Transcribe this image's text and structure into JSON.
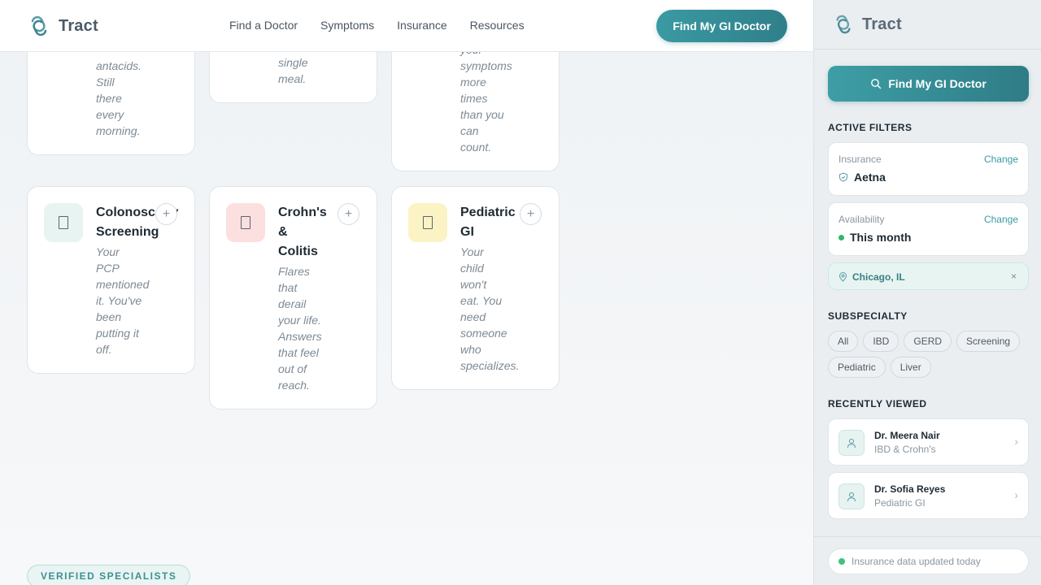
{
  "header": {
    "brand": "Tract",
    "nav": [
      "Find a Doctor",
      "Symptoms",
      "Insurance",
      "Resources"
    ],
    "cta": "Find My GI Doctor"
  },
  "partial_cards": [
    {
      "lines": [
        "antacids.",
        "Still",
        "there",
        "every",
        "morning."
      ]
    },
    {
      "lines": [
        "single",
        "meal."
      ]
    },
    {
      "lines": [
        "your",
        "symptoms",
        "more",
        "times",
        "than you",
        "can",
        "count."
      ]
    }
  ],
  "cards": [
    {
      "title_lines": [
        "Colonoscopy",
        "Screening"
      ],
      "desc_lines": [
        "Your",
        "PCP",
        "mentioned",
        "it. You've",
        "been",
        "putting it",
        "off."
      ],
      "icon_bg": "#e8f4f2",
      "icon": "document-icon"
    },
    {
      "title_lines": [
        "Crohn's",
        "&",
        "Colitis"
      ],
      "desc_lines": [
        "Flares",
        "that",
        "derail",
        "your life.",
        "Answers",
        "that feel",
        "out of",
        "reach."
      ],
      "icon_bg": "#fbe0df",
      "icon": "document-icon"
    },
    {
      "title_lines": [
        "Pediatric",
        "GI"
      ],
      "desc_lines": [
        "Your",
        "child",
        "won't",
        "eat. You",
        "need",
        "someone",
        "who",
        "specializes."
      ],
      "icon_bg": "#fbf3c4",
      "icon": "document-icon"
    }
  ],
  "badge": "VERIFIED SPECIALISTS",
  "sidebar": {
    "brand": "Tract",
    "cta": "Find My GI Doctor",
    "active_filters_title": "ACTIVE FILTERS",
    "filters": [
      {
        "label": "Insurance",
        "value": "Aetna",
        "change": "Change"
      },
      {
        "label": "Availability",
        "value": "This month",
        "change": "Change"
      }
    ],
    "location": "Chicago, IL",
    "location_close": "×",
    "subspecialty_title": "SUBSPECIALTY",
    "subspecialties": [
      "All",
      "IBD",
      "GERD",
      "Screening",
      "Pediatric",
      "Liver"
    ],
    "recent_title": "RECENTLY VIEWED",
    "recent": [
      {
        "name": "Dr. Meera Nair",
        "specialty": "IBD & Crohn's"
      },
      {
        "name": "Dr. Sofia Reyes",
        "specialty": "Pediatric GI"
      }
    ],
    "status": "Insurance data updated today"
  },
  "colors": {
    "accent": "#3a9aa2",
    "accent_dark": "#2f7f8a",
    "status_green": "#2fb86a"
  }
}
